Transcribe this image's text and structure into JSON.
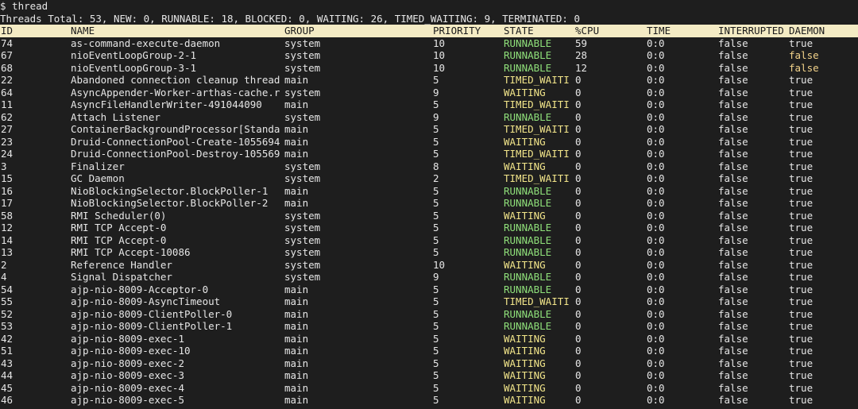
{
  "terminal": {
    "prompt": "$ thread",
    "summary": "Threads Total: 53, NEW: 0, RUNNABLE: 18, BLOCKED: 0, WAITING: 26, TIMED_WAITING: 9, TERMINATED: 0"
  },
  "table": {
    "columns": [
      "ID",
      "NAME",
      "GROUP",
      "PRIORITY",
      "STATE",
      "%CPU",
      "TIME",
      "INTERRUPTED",
      "DAEMON"
    ],
    "rows": [
      {
        "id": "74",
        "name": "as-command-execute-daemon",
        "group": "system",
        "priority": "10",
        "state": "RUNNABLE",
        "cpu": "59",
        "time": "0:0",
        "interrupted": "false",
        "daemon": "true"
      },
      {
        "id": "67",
        "name": "nioEventLoopGroup-2-1",
        "group": "system",
        "priority": "10",
        "state": "RUNNABLE",
        "cpu": "28",
        "time": "0:0",
        "interrupted": "false",
        "daemon": "false"
      },
      {
        "id": "68",
        "name": "nioEventLoopGroup-3-1",
        "group": "system",
        "priority": "10",
        "state": "RUNNABLE",
        "cpu": "12",
        "time": "0:0",
        "interrupted": "false",
        "daemon": "false"
      },
      {
        "id": "22",
        "name": "Abandoned connection cleanup thread",
        "group": "main",
        "priority": "5",
        "state": "TIMED_WAITI",
        "cpu": "0",
        "time": "0:0",
        "interrupted": "false",
        "daemon": "true"
      },
      {
        "id": "64",
        "name": "AsyncAppender-Worker-arthas-cache.r",
        "group": "system",
        "priority": "9",
        "state": "WAITING",
        "cpu": "0",
        "time": "0:0",
        "interrupted": "false",
        "daemon": "true"
      },
      {
        "id": "11",
        "name": "AsyncFileHandlerWriter-491044090",
        "group": "main",
        "priority": "5",
        "state": "TIMED_WAITI",
        "cpu": "0",
        "time": "0:0",
        "interrupted": "false",
        "daemon": "true"
      },
      {
        "id": "62",
        "name": "Attach Listener",
        "group": "system",
        "priority": "9",
        "state": "RUNNABLE",
        "cpu": "0",
        "time": "0:0",
        "interrupted": "false",
        "daemon": "true"
      },
      {
        "id": "27",
        "name": "ContainerBackgroundProcessor[Standa",
        "group": "main",
        "priority": "5",
        "state": "TIMED_WAITI",
        "cpu": "0",
        "time": "0:0",
        "interrupted": "false",
        "daemon": "true"
      },
      {
        "id": "23",
        "name": "Druid-ConnectionPool-Create-1055694",
        "group": "main",
        "priority": "5",
        "state": "WAITING",
        "cpu": "0",
        "time": "0:0",
        "interrupted": "false",
        "daemon": "true"
      },
      {
        "id": "24",
        "name": "Druid-ConnectionPool-Destroy-105569",
        "group": "main",
        "priority": "5",
        "state": "TIMED_WAITI",
        "cpu": "0",
        "time": "0:0",
        "interrupted": "false",
        "daemon": "true"
      },
      {
        "id": "3",
        "name": "Finalizer",
        "group": "system",
        "priority": "8",
        "state": "WAITING",
        "cpu": "0",
        "time": "0:0",
        "interrupted": "false",
        "daemon": "true"
      },
      {
        "id": "15",
        "name": "GC Daemon",
        "group": "system",
        "priority": "2",
        "state": "TIMED_WAITI",
        "cpu": "0",
        "time": "0:0",
        "interrupted": "false",
        "daemon": "true"
      },
      {
        "id": "16",
        "name": "NioBlockingSelector.BlockPoller-1",
        "group": "main",
        "priority": "5",
        "state": "RUNNABLE",
        "cpu": "0",
        "time": "0:0",
        "interrupted": "false",
        "daemon": "true"
      },
      {
        "id": "17",
        "name": "NioBlockingSelector.BlockPoller-2",
        "group": "main",
        "priority": "5",
        "state": "RUNNABLE",
        "cpu": "0",
        "time": "0:0",
        "interrupted": "false",
        "daemon": "true"
      },
      {
        "id": "58",
        "name": "RMI Scheduler(0)",
        "group": "system",
        "priority": "5",
        "state": "WAITING",
        "cpu": "0",
        "time": "0:0",
        "interrupted": "false",
        "daemon": "true"
      },
      {
        "id": "12",
        "name": "RMI TCP Accept-0",
        "group": "system",
        "priority": "5",
        "state": "RUNNABLE",
        "cpu": "0",
        "time": "0:0",
        "interrupted": "false",
        "daemon": "true"
      },
      {
        "id": "14",
        "name": "RMI TCP Accept-0",
        "group": "system",
        "priority": "5",
        "state": "RUNNABLE",
        "cpu": "0",
        "time": "0:0",
        "interrupted": "false",
        "daemon": "true"
      },
      {
        "id": "13",
        "name": "RMI TCP Accept-10086",
        "group": "system",
        "priority": "5",
        "state": "RUNNABLE",
        "cpu": "0",
        "time": "0:0",
        "interrupted": "false",
        "daemon": "true"
      },
      {
        "id": "2",
        "name": "Reference Handler",
        "group": "system",
        "priority": "10",
        "state": "WAITING",
        "cpu": "0",
        "time": "0:0",
        "interrupted": "false",
        "daemon": "true"
      },
      {
        "id": "4",
        "name": "Signal Dispatcher",
        "group": "system",
        "priority": "9",
        "state": "RUNNABLE",
        "cpu": "0",
        "time": "0:0",
        "interrupted": "false",
        "daemon": "true"
      },
      {
        "id": "54",
        "name": "ajp-nio-8009-Acceptor-0",
        "group": "main",
        "priority": "5",
        "state": "RUNNABLE",
        "cpu": "0",
        "time": "0:0",
        "interrupted": "false",
        "daemon": "true"
      },
      {
        "id": "55",
        "name": "ajp-nio-8009-AsyncTimeout",
        "group": "main",
        "priority": "5",
        "state": "TIMED_WAITI",
        "cpu": "0",
        "time": "0:0",
        "interrupted": "false",
        "daemon": "true"
      },
      {
        "id": "52",
        "name": "ajp-nio-8009-ClientPoller-0",
        "group": "main",
        "priority": "5",
        "state": "RUNNABLE",
        "cpu": "0",
        "time": "0:0",
        "interrupted": "false",
        "daemon": "true"
      },
      {
        "id": "53",
        "name": "ajp-nio-8009-ClientPoller-1",
        "group": "main",
        "priority": "5",
        "state": "RUNNABLE",
        "cpu": "0",
        "time": "0:0",
        "interrupted": "false",
        "daemon": "true"
      },
      {
        "id": "42",
        "name": "ajp-nio-8009-exec-1",
        "group": "main",
        "priority": "5",
        "state": "WAITING",
        "cpu": "0",
        "time": "0:0",
        "interrupted": "false",
        "daemon": "true"
      },
      {
        "id": "51",
        "name": "ajp-nio-8009-exec-10",
        "group": "main",
        "priority": "5",
        "state": "WAITING",
        "cpu": "0",
        "time": "0:0",
        "interrupted": "false",
        "daemon": "true"
      },
      {
        "id": "43",
        "name": "ajp-nio-8009-exec-2",
        "group": "main",
        "priority": "5",
        "state": "WAITING",
        "cpu": "0",
        "time": "0:0",
        "interrupted": "false",
        "daemon": "true"
      },
      {
        "id": "44",
        "name": "ajp-nio-8009-exec-3",
        "group": "main",
        "priority": "5",
        "state": "WAITING",
        "cpu": "0",
        "time": "0:0",
        "interrupted": "false",
        "daemon": "true"
      },
      {
        "id": "45",
        "name": "ajp-nio-8009-exec-4",
        "group": "main",
        "priority": "5",
        "state": "WAITING",
        "cpu": "0",
        "time": "0:0",
        "interrupted": "false",
        "daemon": "true"
      },
      {
        "id": "46",
        "name": "ajp-nio-8009-exec-5",
        "group": "main",
        "priority": "5",
        "state": "WAITING",
        "cpu": "0",
        "time": "0:0",
        "interrupted": "false",
        "daemon": "true"
      }
    ]
  },
  "colors": {
    "background": "#1e1e1e",
    "header_bg": "#f4ebc4",
    "runnable": "#8fe07a",
    "waiting": "#f2e58a",
    "daemon_false": "#f2d28a"
  }
}
